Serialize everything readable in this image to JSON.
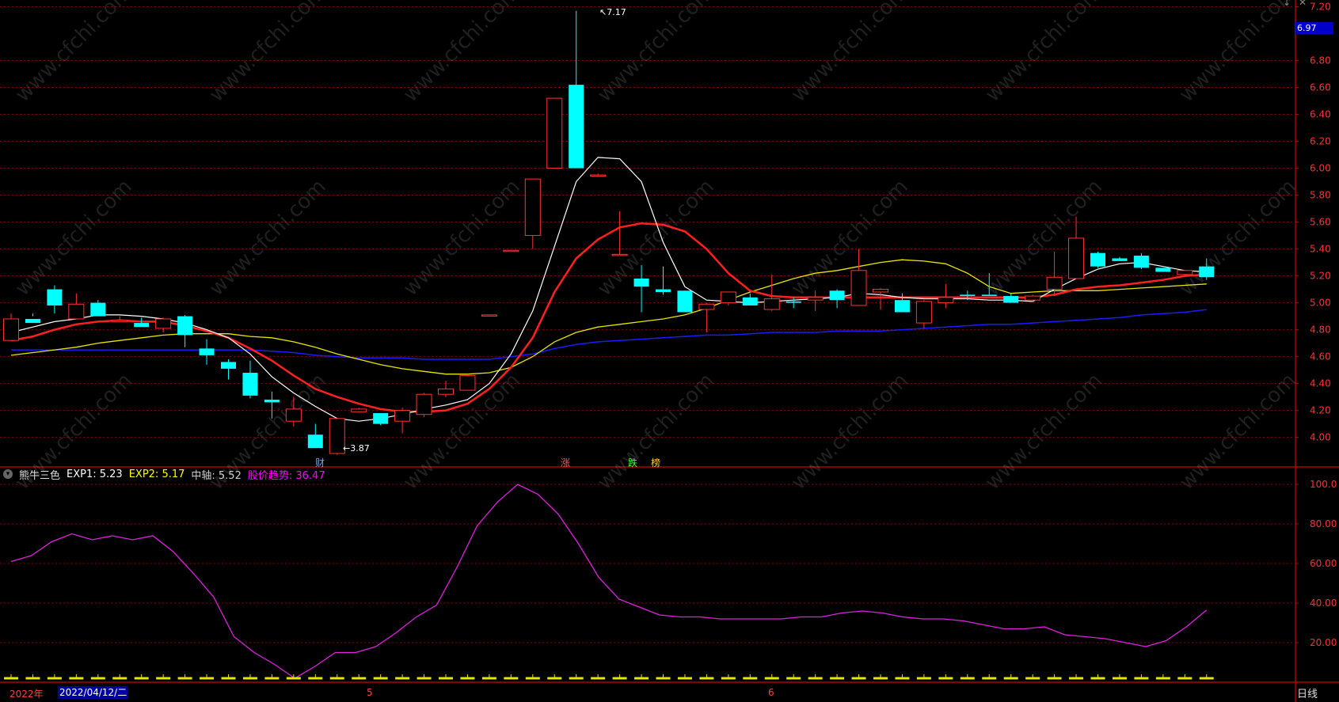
{
  "main_header": "",
  "top_controls": [
    "↓",
    "✕"
  ],
  "price_axis_ticks": [
    "7.20",
    "6.80",
    "6.60",
    "6.40",
    "6.20",
    "6.00",
    "5.80",
    "5.60",
    "5.40",
    "5.20",
    "5.00",
    "4.80",
    "4.60",
    "4.40",
    "4.20",
    "4.00"
  ],
  "current_price": "6.97",
  "osc_axis_ticks": [
    "100.0",
    "80.00",
    "60.00",
    "40.00",
    "20.00"
  ],
  "high_marker": "7.17",
  "low_marker": "3.87",
  "signals": [
    "财",
    "涨",
    "跌",
    "榜"
  ],
  "indicator": {
    "name": "熊牛三色",
    "items": [
      {
        "label": "EXP1: 5.23",
        "color": "#ffffff"
      },
      {
        "label": "EXP2: 5.17",
        "color": "#ffff00"
      },
      {
        "label": "中轴: 5.52",
        "color": "#cfcfcf"
      },
      {
        "label": "股价趋势: 36.47",
        "color": "#ff00ff"
      }
    ]
  },
  "bottom": {
    "year": "2022年",
    "current_date": "2022/04/12/二",
    "month_labels": [
      "5",
      "6"
    ],
    "period": "日线"
  },
  "watermark": "www.cfchi.com",
  "colors": {
    "up": "#ff3232",
    "down": "#00ffff",
    "ma_fast": "#ffffff",
    "ma_mid": "#ff2020",
    "ma_slow": "#e6e600",
    "ma_long": "#1a1aff",
    "osc": "#e020e0",
    "grid": "#8b0000"
  },
  "chart_data": {
    "type": "candlestick",
    "ylim": [
      3.78,
      7.25
    ],
    "ohlc": [
      [
        4.72,
        4.92,
        4.72,
        4.88
      ],
      [
        4.88,
        4.92,
        4.9,
        4.85
      ],
      [
        5.1,
        5.13,
        4.92,
        4.98
      ],
      [
        4.88,
        5.07,
        4.88,
        4.99
      ],
      [
        5.0,
        5.02,
        4.91,
        4.9
      ],
      [
        4.86,
        4.9,
        4.86,
        4.87
      ],
      [
        4.85,
        4.89,
        4.85,
        4.82
      ],
      [
        4.81,
        4.89,
        4.78,
        4.88
      ],
      [
        4.9,
        4.91,
        4.67,
        4.76
      ],
      [
        4.66,
        4.73,
        4.54,
        4.61
      ],
      [
        4.56,
        4.58,
        4.43,
        4.51
      ],
      [
        4.48,
        4.57,
        4.29,
        4.31
      ],
      [
        4.28,
        4.34,
        4.14,
        4.26
      ],
      [
        4.12,
        4.3,
        4.08,
        4.21
      ],
      [
        4.02,
        4.1,
        3.92,
        3.92
      ],
      [
        3.88,
        4.13,
        3.87,
        4.14
      ],
      [
        4.19,
        4.22,
        4.19,
        4.21
      ],
      [
        4.18,
        4.18,
        4.09,
        4.1
      ],
      [
        4.12,
        4.22,
        4.03,
        4.2
      ],
      [
        4.17,
        4.33,
        4.15,
        4.32
      ],
      [
        4.32,
        4.42,
        4.3,
        4.36
      ],
      [
        4.35,
        4.47,
        4.35,
        4.46
      ],
      [
        4.91,
        4.91,
        4.91,
        4.91
      ],
      [
        5.39,
        5.39,
        5.39,
        5.39
      ],
      [
        5.5,
        5.92,
        5.4,
        5.92
      ],
      [
        6.0,
        6.52,
        6.0,
        6.52
      ],
      [
        6.62,
        7.17,
        6.32,
        6.0
      ],
      [
        5.95,
        5.96,
        5.94,
        5.95
      ],
      [
        5.36,
        5.68,
        5.36,
        5.36
      ],
      [
        5.18,
        5.28,
        4.93,
        5.12
      ],
      [
        5.1,
        5.27,
        5.06,
        5.08
      ],
      [
        5.09,
        5.09,
        4.93,
        4.93
      ],
      [
        4.95,
        5.0,
        4.78,
        4.99
      ],
      [
        5.0,
        5.08,
        4.98,
        5.08
      ],
      [
        5.04,
        5.07,
        4.98,
        4.98
      ],
      [
        4.95,
        5.21,
        4.94,
        5.03
      ],
      [
        5.01,
        5.04,
        4.96,
        5.0
      ],
      [
        5.02,
        5.09,
        4.94,
        5.04
      ],
      [
        5.09,
        5.1,
        4.96,
        5.02
      ],
      [
        4.98,
        5.4,
        4.98,
        5.24
      ],
      [
        5.08,
        5.11,
        4.95,
        5.1
      ],
      [
        5.02,
        5.07,
        4.95,
        4.93
      ],
      [
        4.85,
        5.02,
        4.81,
        5.01
      ],
      [
        5.0,
        5.14,
        4.96,
        5.04
      ],
      [
        5.06,
        5.09,
        5.02,
        5.05
      ],
      [
        5.06,
        5.22,
        5.05,
        5.05
      ],
      [
        5.05,
        5.07,
        5.0,
        5.0
      ],
      [
        5.02,
        5.06,
        5.01,
        5.05
      ],
      [
        5.1,
        5.38,
        5.05,
        5.19
      ],
      [
        5.18,
        5.64,
        5.18,
        5.48
      ],
      [
        5.37,
        5.38,
        5.26,
        5.27
      ],
      [
        5.33,
        5.34,
        5.31,
        5.31
      ],
      [
        5.35,
        5.37,
        5.25,
        5.26
      ],
      [
        5.26,
        5.26,
        5.24,
        5.23
      ],
      [
        5.21,
        5.24,
        5.2,
        5.24
      ],
      [
        5.27,
        5.33,
        5.17,
        5.19
      ]
    ],
    "lines": {
      "ma_fast": [
        4.78,
        4.82,
        4.86,
        4.88,
        4.91,
        4.91,
        4.9,
        4.88,
        4.85,
        4.8,
        4.74,
        4.62,
        4.45,
        4.33,
        4.23,
        4.14,
        4.12,
        4.14,
        4.17,
        4.21,
        4.24,
        4.28,
        4.4,
        4.62,
        4.94,
        5.42,
        5.9,
        6.08,
        6.07,
        5.9,
        5.45,
        5.12,
        5.02,
        5.01,
        5.0,
        5.01,
        5.02,
        5.03,
        5.04,
        5.07,
        5.06,
        5.04,
        5.03,
        5.03,
        5.03,
        5.02,
        5.02,
        5.01,
        5.1,
        5.18,
        5.25,
        5.29,
        5.3,
        5.27,
        5.24,
        5.23
      ],
      "ma_mid": [
        4.72,
        4.75,
        4.8,
        4.84,
        4.86,
        4.87,
        4.86,
        4.86,
        4.83,
        4.79,
        4.74,
        4.66,
        4.57,
        4.46,
        4.36,
        4.3,
        4.25,
        4.21,
        4.19,
        4.19,
        4.2,
        4.25,
        4.36,
        4.52,
        4.74,
        5.08,
        5.33,
        5.47,
        5.56,
        5.59,
        5.58,
        5.53,
        5.4,
        5.22,
        5.09,
        5.05,
        5.04,
        5.04,
        5.04,
        5.04,
        5.04,
        5.04,
        5.04,
        5.04,
        5.04,
        5.04,
        5.04,
        5.04,
        5.06,
        5.1,
        5.12,
        5.13,
        5.15,
        5.17,
        5.2,
        5.21
      ],
      "ma_slow": [
        4.61,
        4.63,
        4.65,
        4.67,
        4.7,
        4.72,
        4.74,
        4.76,
        4.77,
        4.77,
        4.77,
        4.75,
        4.74,
        4.71,
        4.67,
        4.62,
        4.58,
        4.54,
        4.51,
        4.49,
        4.47,
        4.47,
        4.48,
        4.52,
        4.6,
        4.71,
        4.78,
        4.82,
        4.84,
        4.86,
        4.88,
        4.91,
        4.96,
        5.02,
        5.08,
        5.13,
        5.18,
        5.22,
        5.24,
        5.27,
        5.3,
        5.32,
        5.31,
        5.29,
        5.22,
        5.12,
        5.07,
        5.08,
        5.09,
        5.09,
        5.09,
        5.1,
        5.11,
        5.12,
        5.13,
        5.14
      ],
      "ma_long": [
        4.65,
        4.65,
        4.65,
        4.65,
        4.65,
        4.65,
        4.65,
        4.65,
        4.65,
        4.65,
        4.65,
        4.65,
        4.64,
        4.63,
        4.61,
        4.6,
        4.59,
        4.59,
        4.59,
        4.58,
        4.58,
        4.58,
        4.58,
        4.6,
        4.62,
        4.66,
        4.69,
        4.71,
        4.72,
        4.73,
        4.74,
        4.75,
        4.76,
        4.76,
        4.77,
        4.78,
        4.78,
        4.78,
        4.79,
        4.79,
        4.79,
        4.8,
        4.81,
        4.82,
        4.83,
        4.84,
        4.84,
        4.85,
        4.86,
        4.87,
        4.88,
        4.89,
        4.91,
        4.92,
        4.93,
        4.95
      ]
    },
    "oscillator": {
      "ylim": [
        0,
        108
      ],
      "values": [
        61,
        64,
        71,
        75,
        72,
        74,
        72,
        74,
        66,
        55,
        43,
        23,
        15,
        9,
        2,
        8,
        15,
        15,
        18,
        25,
        33,
        39,
        58,
        79,
        91,
        100,
        95,
        85,
        70,
        53,
        42,
        38,
        34,
        33,
        33,
        32,
        32,
        32,
        32,
        33,
        33,
        35,
        36,
        35,
        33,
        32,
        32,
        31,
        29,
        27,
        27,
        28,
        24,
        23,
        22,
        20,
        18,
        21,
        28,
        36.47
      ]
    }
  }
}
